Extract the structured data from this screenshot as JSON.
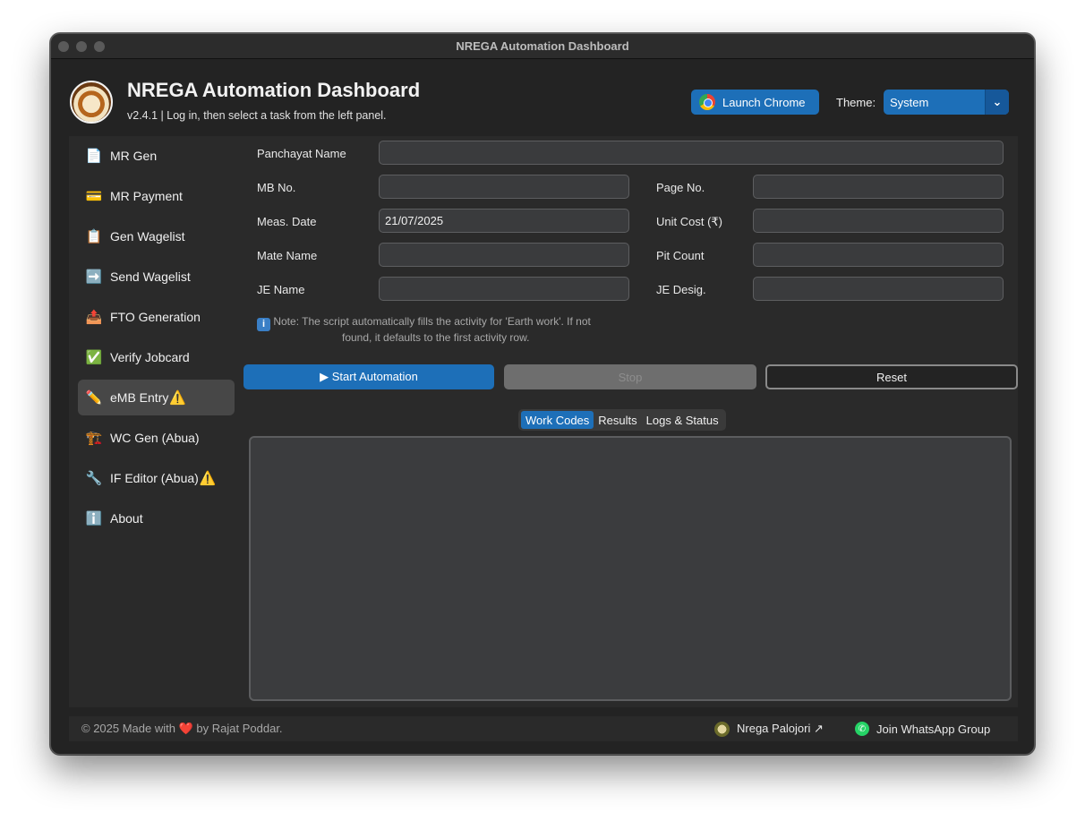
{
  "window": {
    "title": "NREGA Automation Dashboard"
  },
  "header": {
    "title": "NREGA Automation Dashboard",
    "subtitle": "v2.4.1 | Log in, then select a task from the left panel.",
    "launch_chrome_label": "Launch Chrome",
    "theme_label": "Theme:",
    "theme_value": "System"
  },
  "sidebar": {
    "items": [
      {
        "label": "MR Gen",
        "icon": "document-icon",
        "glyph": "📄",
        "warning": ""
      },
      {
        "label": "MR Payment",
        "icon": "credit-card-icon",
        "glyph": "💳",
        "warning": ""
      },
      {
        "label": "Gen Wagelist",
        "icon": "clipboard-icon",
        "glyph": "📋",
        "warning": ""
      },
      {
        "label": "Send Wagelist",
        "icon": "arrow-right-icon",
        "glyph": "➡️",
        "warning": ""
      },
      {
        "label": "FTO Generation",
        "icon": "outbox-tray-icon",
        "glyph": "📤",
        "warning": ""
      },
      {
        "label": "Verify Jobcard",
        "icon": "check-box-icon",
        "glyph": "✅",
        "warning": ""
      },
      {
        "label": "eMB Entry",
        "icon": "pencil-icon",
        "glyph": "✏️",
        "warning": "⚠️",
        "active": true
      },
      {
        "label": "WC Gen (Abua)",
        "icon": "construction-crane-icon",
        "glyph": "🏗️",
        "warning": ""
      },
      {
        "label": "IF Editor (Abua)",
        "icon": "wrench-icon",
        "glyph": "🔧",
        "warning": "⚠️"
      },
      {
        "label": "About",
        "icon": "info-icon",
        "glyph": "ℹ️",
        "warning": ""
      }
    ]
  },
  "form": {
    "panchayat_name": {
      "label": "Panchayat Name",
      "value": ""
    },
    "mb_no": {
      "label": "MB No.",
      "value": ""
    },
    "page_no": {
      "label": "Page No.",
      "value": ""
    },
    "meas_date": {
      "label": "Meas. Date",
      "value": "21/07/2025"
    },
    "unit_cost": {
      "label": "Unit Cost (₹)",
      "value": ""
    },
    "mate_name": {
      "label": "Mate Name",
      "value": ""
    },
    "pit_count": {
      "label": "Pit Count",
      "value": ""
    },
    "je_name": {
      "label": "JE Name",
      "value": ""
    },
    "je_desig": {
      "label": "JE Desig.",
      "value": ""
    },
    "note_line1": "Note: The script automatically fills the activity for 'Earth work'. If not",
    "note_line2": "found, it defaults to the first activity row."
  },
  "actions": {
    "start_label": "▶ Start Automation",
    "stop_label": "Stop",
    "reset_label": "Reset"
  },
  "tabs": {
    "items": [
      "Work Codes",
      "Results",
      "Logs & Status"
    ],
    "active": "Work Codes"
  },
  "footer": {
    "copyright_prefix": "© 2025 Made with",
    "heart": "❤️",
    "copyright_suffix": "by Rajat Poddar.",
    "palojori_label": "Nrega Palojori ↗",
    "whatsapp_label": "Join WhatsApp Group"
  },
  "colors": {
    "accent": "#1d6fb8",
    "window_bg": "#232323",
    "panel_bg": "#2a2a2a",
    "input_bg": "#3a3b3d",
    "warning": "#f5c518"
  }
}
